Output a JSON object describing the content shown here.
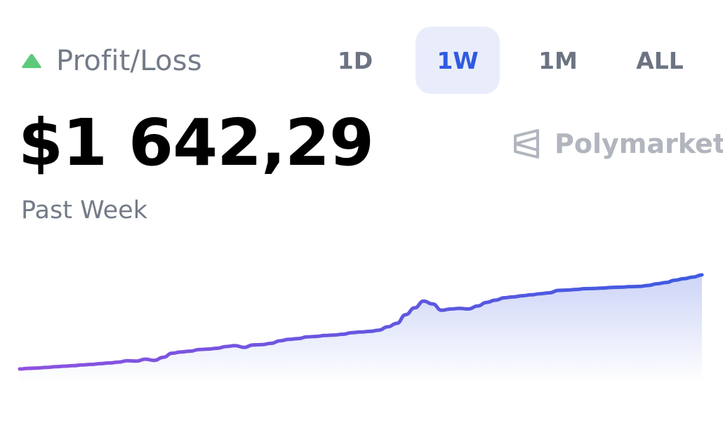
{
  "header": {
    "label": "Profit/Loss",
    "trend_icon": "triangle-up-icon",
    "trend_color": "#5cc97b"
  },
  "range_tabs": [
    {
      "label": "1D",
      "active": false
    },
    {
      "label": "1W",
      "active": true
    },
    {
      "label": "1M",
      "active": false
    },
    {
      "label": "ALL",
      "active": false
    }
  ],
  "amount": "$1 642,29",
  "brand": {
    "name": "Polymarket",
    "icon": "polymarket-logo-icon"
  },
  "period_label": "Past Week",
  "colors": {
    "line_start": "#8e52e0",
    "line_end": "#3d5be0",
    "fill": "#3d5be0",
    "active_tab_bg": "#e9edfb",
    "active_tab_text": "#2f5be0"
  },
  "chart_data": {
    "type": "area",
    "grid": false,
    "values": [
      0,
      0.5,
      0.8,
      1.2,
      1.8,
      2.2,
      2.6,
      3.2,
      3.6,
      4.2,
      4.8,
      5.4,
      6.5,
      6.2,
      7.8,
      6.8,
      9.2,
      12.5,
      13.5,
      14.1,
      15.4,
      15.8,
      16.4,
      17.8,
      18.5,
      17.1,
      19.0,
      19.3,
      20.3,
      22.3,
      23.5,
      24.0,
      25.4,
      25.8,
      26.5,
      26.9,
      27.5,
      28.8,
      29.3,
      29.8,
      30.7,
      33.4,
      36.1,
      43.0,
      48.4,
      53.8,
      51.5,
      46.5,
      47.5,
      48.0,
      47.5,
      49.9,
      52.7,
      54.5,
      56.4,
      57.1,
      58.0,
      58.7,
      59.6,
      60.3,
      62.2,
      62.5,
      63.0,
      63.6,
      63.8,
      64.1,
      64.6,
      64.8,
      65.2,
      65.4,
      66.1,
      67.5,
      68.5,
      70.3,
      71.5,
      72.8,
      74.5
    ]
  }
}
